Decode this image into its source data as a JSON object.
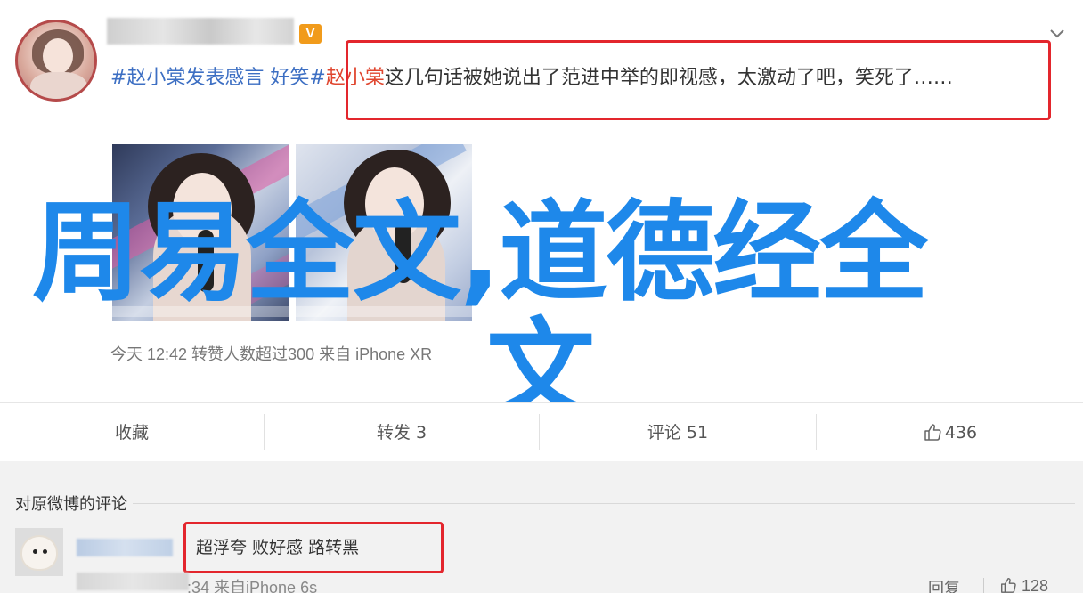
{
  "post": {
    "vip_badge": "V",
    "text_topic": "#赵小棠发表感言 好笑#",
    "text_mention": "赵小棠",
    "text_body": "这几句话被她说出了范进中举的即视感，太激动了吧，笑死了……",
    "meta": "今天 12:42 转赞人数超过300  来自 iPhone XR"
  },
  "overlay": {
    "line1": "周易全文,道德经全",
    "line2": "文"
  },
  "actions": {
    "favorite": "收藏",
    "repost": "转发 3",
    "comment": "评论 51",
    "like": "436"
  },
  "comments": {
    "title": "对原微博的评论",
    "items": [
      {
        "text": "超浮夸 败好感 路转黑",
        "time": ":34 来自iPhone 6s",
        "reply": "回复",
        "likes": "128"
      }
    ]
  },
  "colors": {
    "highlight": "#e3262d",
    "overlay_text": "#1e88ea",
    "topic_link": "#3d6fc3",
    "mention": "#e0462f"
  },
  "icons": [
    "chevron-down-icon",
    "thumbs-up-icon"
  ]
}
